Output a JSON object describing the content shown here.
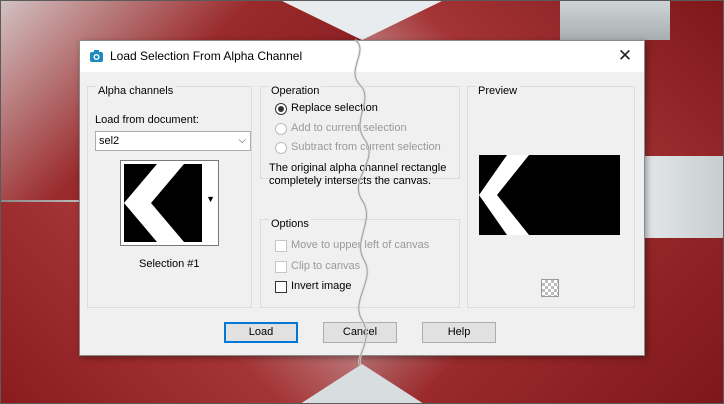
{
  "dialog": {
    "title": "Load Selection From Alpha Channel",
    "close_glyph": "✕"
  },
  "alpha_channels": {
    "group_title": "Alpha channels",
    "load_from_label": "Load from document:",
    "document_value": "sel2",
    "selection_label": "Selection #1"
  },
  "operation": {
    "group_title": "Operation",
    "options": [
      {
        "label": "Replace selection",
        "selected": true,
        "enabled": true
      },
      {
        "label": "Add to current selection",
        "selected": false,
        "enabled": false
      },
      {
        "label": "Subtract from current selection",
        "selected": false,
        "enabled": false
      }
    ],
    "info_text": "The original alpha channel rectangle completely intersects the canvas."
  },
  "options": {
    "group_title": "Options",
    "items": [
      {
        "label": "Move to upper left of canvas",
        "checked": false,
        "enabled": false
      },
      {
        "label": "Clip to canvas",
        "checked": false,
        "enabled": false
      },
      {
        "label": "Invert image",
        "checked": false,
        "enabled": true
      }
    ]
  },
  "preview": {
    "group_title": "Preview"
  },
  "buttons": {
    "load": "Load",
    "cancel": "Cancel",
    "help": "Help"
  },
  "colors": {
    "accent": "#0078d7",
    "dialog_bg": "#f0f0f0",
    "background_red": "#8d1c1f"
  },
  "icons": {
    "app": "camera-icon",
    "close": "close-icon",
    "combo_arrow": "chevron-down-icon",
    "thumb_arrow": "triangle-down-icon",
    "checker": "transparency-checker-icon"
  }
}
